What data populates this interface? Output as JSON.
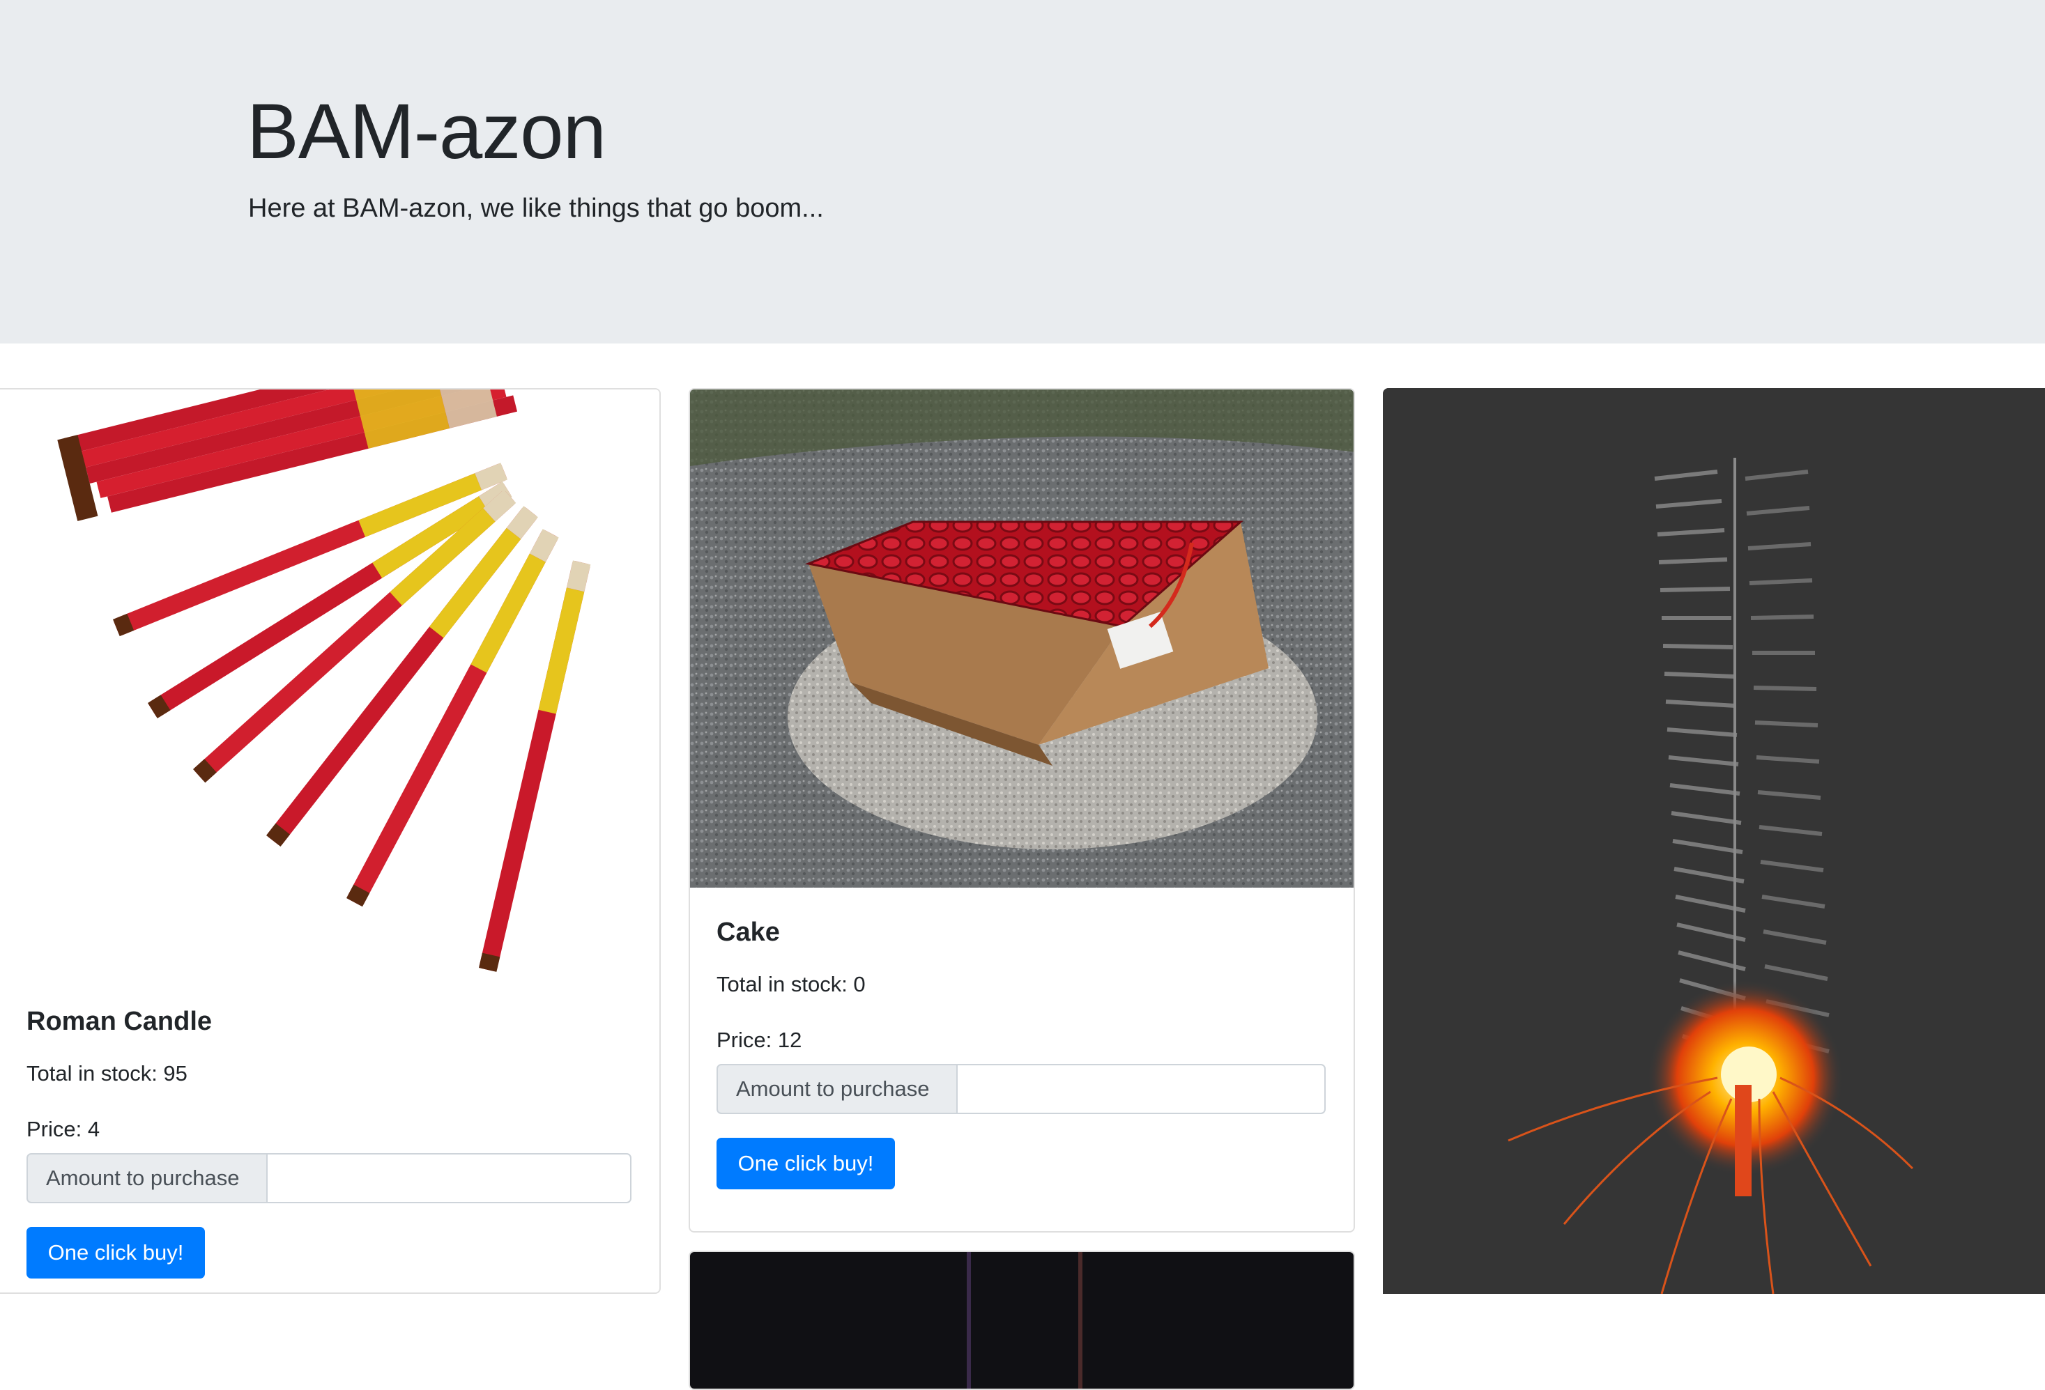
{
  "header": {
    "title": "BAM-azon",
    "tagline": "Here at BAM-azon, we like things that go boom..."
  },
  "products": [
    {
      "name": "Roman Candle",
      "stock_label": "Total in stock: 95",
      "price_label": "Price: 4",
      "amount_label": "Amount to purchase",
      "amount_value": "",
      "buy_label": "One click buy!",
      "image_icon": "roman-candle-bundle-image"
    },
    {
      "name": "Cake",
      "stock_label": "Total in stock: 0",
      "price_label": "Price: 12",
      "amount_label": "Amount to purchase",
      "amount_value": "",
      "buy_label": "One click buy!",
      "image_icon": "firework-cake-box-image"
    }
  ],
  "colors": {
    "jumbotron_bg": "#e9ecef",
    "primary": "#007bff"
  }
}
